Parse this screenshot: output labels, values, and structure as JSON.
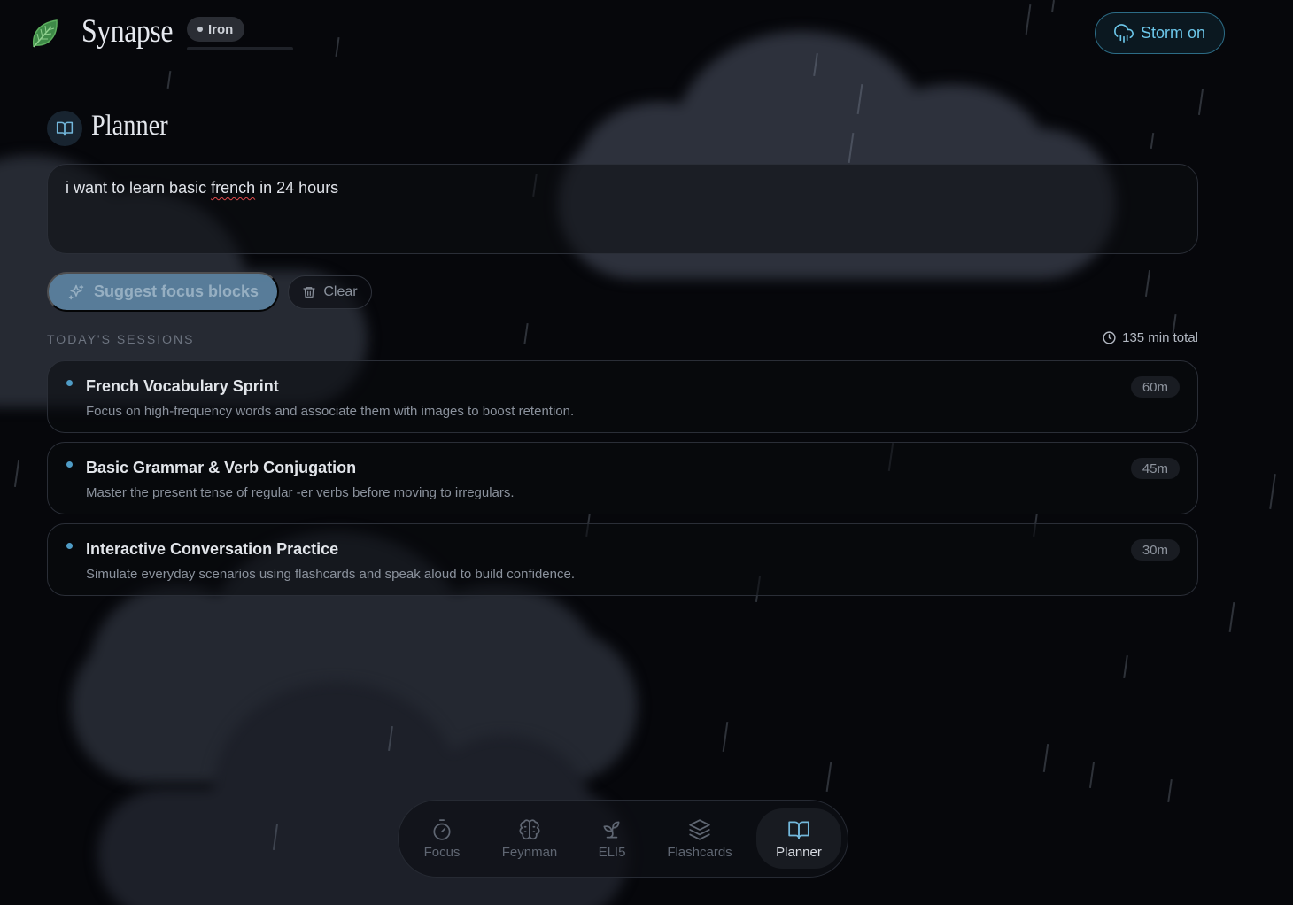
{
  "header": {
    "brand": "Synapse",
    "rank": "Iron",
    "storm_label": "Storm on",
    "accent_color": "#6cc7ea",
    "logo_icon": "leaf-icon"
  },
  "planner": {
    "title": "Planner",
    "goal_text_before": "i want to learn basic ",
    "goal_text_misspelled": "french",
    "goal_text_after": " in 24 hours",
    "suggest_label": "Suggest focus blocks",
    "clear_label": "Clear",
    "sessions_label": "TODAY'S SESSIONS",
    "total_label": "135 min total"
  },
  "sessions": [
    {
      "title": "French Vocabulary Sprint",
      "desc": "Focus on high-frequency words and associate them with images to boost retention.",
      "duration": "60m"
    },
    {
      "title": "Basic Grammar & Verb Conjugation",
      "desc": "Master the present tense of regular -er verbs before moving to irregulars.",
      "duration": "45m"
    },
    {
      "title": "Interactive Conversation Practice",
      "desc": "Simulate everyday scenarios using flashcards and speak aloud to build confidence.",
      "duration": "30m"
    }
  ],
  "nav": [
    {
      "label": "Focus",
      "icon": "timer-icon"
    },
    {
      "label": "Feynman",
      "icon": "brain-icon"
    },
    {
      "label": "ELI5",
      "icon": "sprout-icon"
    },
    {
      "label": "Flashcards",
      "icon": "layers-icon"
    },
    {
      "label": "Planner",
      "icon": "book-open-icon",
      "active": true
    }
  ]
}
